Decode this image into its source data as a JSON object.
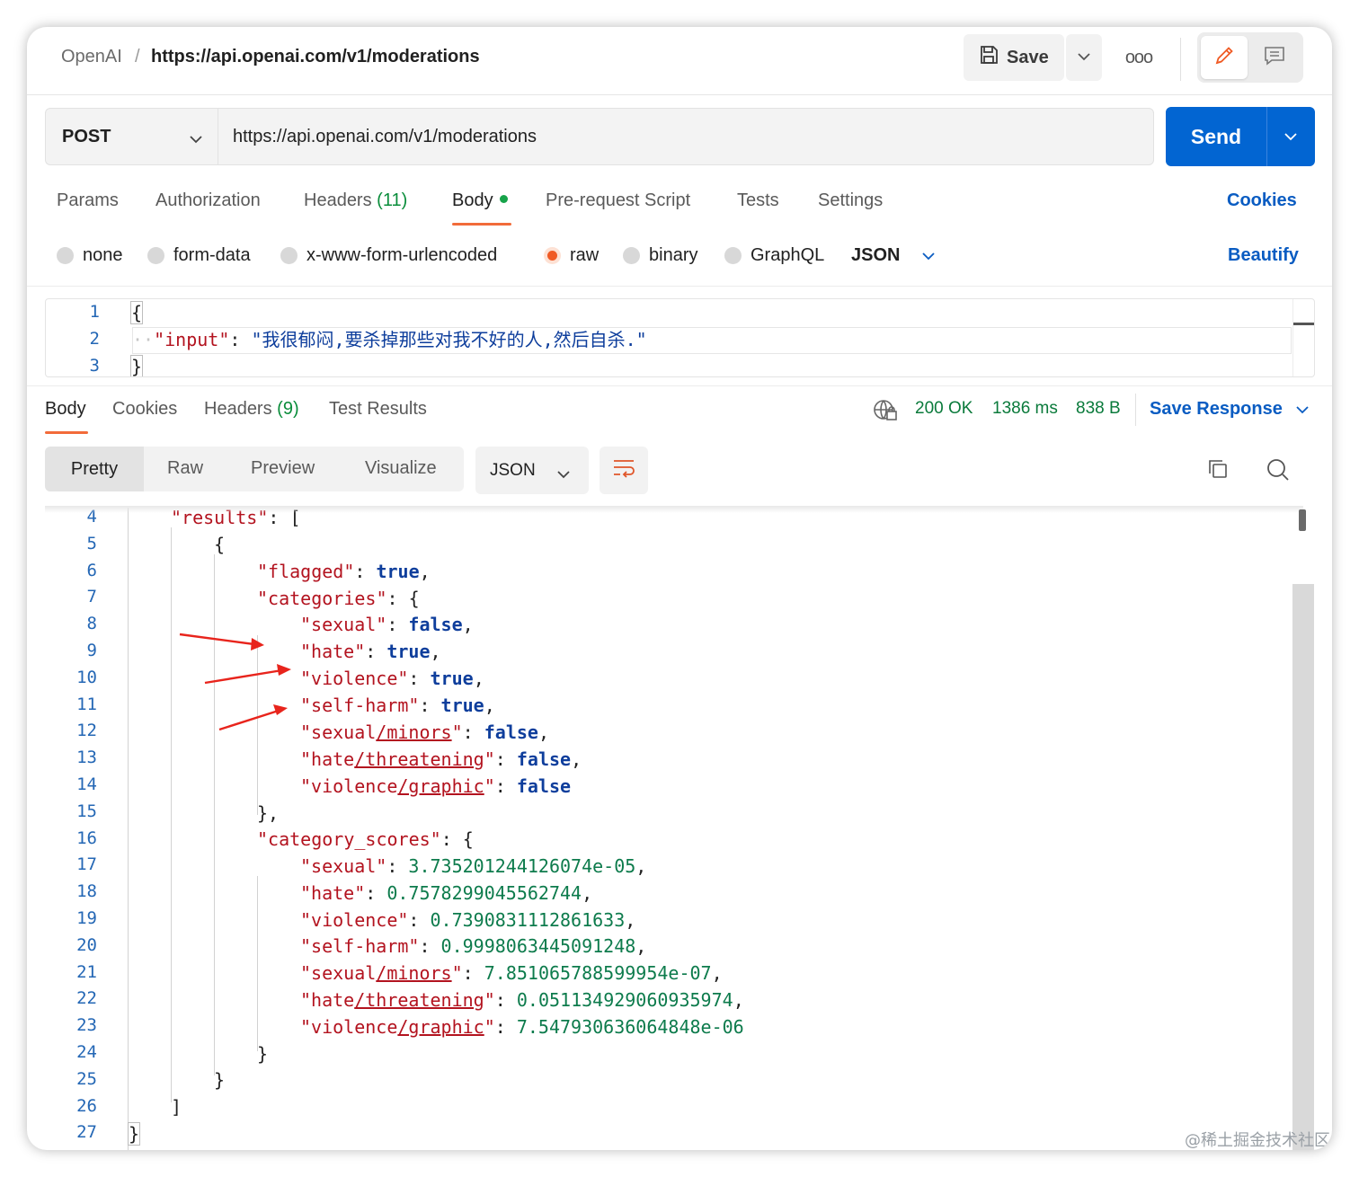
{
  "breadcrumb": {
    "workspace": "OpenAI",
    "separator": "/",
    "request_name": "https://api.openai.com/v1/moderations"
  },
  "toolbar": {
    "save_label": "Save",
    "more_label": "ooo"
  },
  "request": {
    "method": "POST",
    "url": "https://api.openai.com/v1/moderations",
    "send_label": "Send"
  },
  "request_tabs": {
    "params": "Params",
    "authorization": "Authorization",
    "headers": "Headers",
    "headers_count": "(11)",
    "body": "Body",
    "pre_request": "Pre-request Script",
    "tests": "Tests",
    "settings": "Settings",
    "cookies": "Cookies"
  },
  "body_types": {
    "none": "none",
    "form_data": "form-data",
    "urlencoded": "x-www-form-urlencoded",
    "raw": "raw",
    "binary": "binary",
    "graphql": "GraphQL",
    "format": "JSON",
    "beautify": "Beautify"
  },
  "request_body": {
    "line_numbers": [
      "1",
      "2",
      "3"
    ],
    "open": "{",
    "key": "\"input\"",
    "colon": ": ",
    "value": "\"我很郁闷,要杀掉那些对我不好的人,然后自杀.\"",
    "close": "}"
  },
  "response_tabs": {
    "body": "Body",
    "cookies": "Cookies",
    "headers": "Headers",
    "headers_count": "(9)",
    "test_results": "Test Results"
  },
  "response_status": {
    "status": "200 OK",
    "time": "1386 ms",
    "size": "838 B",
    "save_response": "Save Response"
  },
  "response_view": {
    "pretty": "Pretty",
    "raw": "Raw",
    "preview": "Preview",
    "visualize": "Visualize",
    "format": "JSON"
  },
  "response_body": {
    "line_numbers": [
      "4",
      "5",
      "6",
      "7",
      "8",
      "9",
      "10",
      "11",
      "12",
      "13",
      "14",
      "15",
      "16",
      "17",
      "18",
      "19",
      "20",
      "21",
      "22",
      "23",
      "24",
      "25",
      "26",
      "27"
    ],
    "results_key": "\"results\"",
    "flagged_key": "\"flagged\"",
    "flagged_val": "true",
    "categories_key": "\"categories\"",
    "scores_key": "\"category_scores\"",
    "cat_keys": {
      "sexual": "\"sexual\"",
      "hate": "\"hate\"",
      "violence": "\"violence\"",
      "self_harm": "\"self-harm\"",
      "sexual_minors_a": "\"sexual",
      "sexual_minors_b": "/minors",
      "hate_threat_a": "\"hate",
      "hate_threat_b": "/threatening",
      "violence_graphic_a": "\"violence",
      "violence_graphic_b": "/graphic",
      "quote": "\""
    },
    "categories": {
      "sexual": "false",
      "hate": "true",
      "violence": "true",
      "self_harm": "true",
      "sexual_minors": "false",
      "hate_threatening": "false",
      "violence_graphic": "false"
    },
    "scores": {
      "sexual": "3.735201244126074e-05",
      "hate": "0.7578299045562744",
      "violence": "0.7390831112861633",
      "self_harm": "0.9998063445091248",
      "sexual_minors": "7.851065788599954e-07",
      "hate_threatening": "0.051134929060935974",
      "violence_graphic": "7.547930636064848e-06"
    }
  },
  "watermark": "@稀土掘金技术社区",
  "colors": {
    "accent": "#f26b3a",
    "send": "#0265d2",
    "link": "#0a5cc2",
    "status_ok": "#0a7a3b",
    "json_key": "#b3131f",
    "json_bool": "#0e3e9c",
    "json_number": "#0d7b4c"
  }
}
